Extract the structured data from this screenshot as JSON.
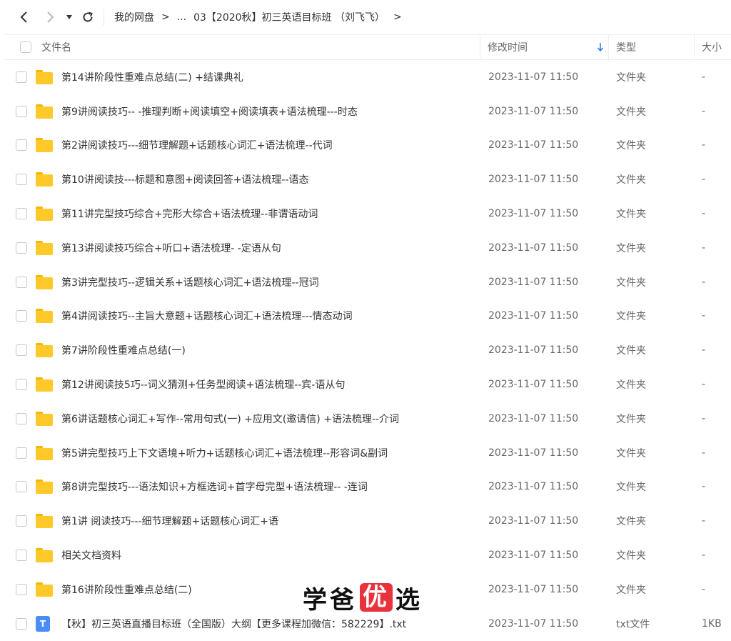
{
  "toolbar": {
    "back_icon": "chevron-left-icon",
    "forward_icon": "chevron-right-icon",
    "dropdown_icon": "caret-down-icon",
    "refresh_icon": "refresh-icon"
  },
  "breadcrumb": {
    "root": "我的网盘",
    "sep": ">",
    "ellipsis": "...",
    "current": "03【2020秋】初三英语目标班 （刘飞飞）",
    "trail_sep": ">"
  },
  "columns": {
    "name": "文件名",
    "modified": "修改时间",
    "type": "类型",
    "size": "大小",
    "sort_icon": "sort-down-arrow-icon"
  },
  "colors": {
    "folder": "#ffc929",
    "txt_icon": "#4a8df8",
    "sort_arrow": "#2f7cf6",
    "watermark_highlight": "#e8323c"
  },
  "files": [
    {
      "name": "第14讲阶段性重难点总结(二) +结课典礼",
      "modified": "2023-11-07 11:50",
      "type": "文件夹",
      "size": "-",
      "icon": "folder-icon"
    },
    {
      "name": "第9讲阅读技巧-- -推理判断+阅读填空+阅读填表+语法梳理---时态",
      "modified": "2023-11-07 11:50",
      "type": "文件夹",
      "size": "-",
      "icon": "folder-icon"
    },
    {
      "name": "第2讲阅读技巧---细节理解题+话题核心词汇+语法梳理--代词",
      "modified": "2023-11-07 11:50",
      "type": "文件夹",
      "size": "-",
      "icon": "folder-icon"
    },
    {
      "name": "第10讲阅读技---标题和意图+阅读回答+语法梳理--语态",
      "modified": "2023-11-07 11:50",
      "type": "文件夹",
      "size": "-",
      "icon": "folder-icon"
    },
    {
      "name": "第11讲完型技巧综合+完形大综合+语法梳理--非谓语动词",
      "modified": "2023-11-07 11:50",
      "type": "文件夹",
      "size": "-",
      "icon": "folder-icon"
    },
    {
      "name": "第13讲阅读技巧综合+听口+语法梳理- -定语从句",
      "modified": "2023-11-07 11:50",
      "type": "文件夹",
      "size": "-",
      "icon": "folder-icon"
    },
    {
      "name": "第3讲完型技巧--逻辑关系+话题核心词汇+语法梳理--冠词",
      "modified": "2023-11-07 11:50",
      "type": "文件夹",
      "size": "-",
      "icon": "folder-icon"
    },
    {
      "name": "第4讲阅读技巧--主旨大意题+话题核心词汇+语法梳理---情态动词",
      "modified": "2023-11-07 11:50",
      "type": "文件夹",
      "size": "-",
      "icon": "folder-icon"
    },
    {
      "name": "第7讲阶段性重难点总结(一)",
      "modified": "2023-11-07 11:50",
      "type": "文件夹",
      "size": "-",
      "icon": "folder-icon"
    },
    {
      "name": "第12讲阅读技5巧--词义猜测+任务型阅读+语法梳理--宾-语从句",
      "modified": "2023-11-07 11:50",
      "type": "文件夹",
      "size": "-",
      "icon": "folder-icon"
    },
    {
      "name": "第6讲话题核心词汇+写作--常用句式(一) +应用文(邀请信) +语法梳理--介词",
      "modified": "2023-11-07 11:50",
      "type": "文件夹",
      "size": "-",
      "icon": "folder-icon"
    },
    {
      "name": "第5讲完型技巧上下文语境+听力+话题核心词汇+语法梳理--形容词&副词",
      "modified": "2023-11-07 11:50",
      "type": "文件夹",
      "size": "-",
      "icon": "folder-icon"
    },
    {
      "name": "第8讲完型技巧---语法知识+方框选词+首字母完型+语法梳理-- -连词",
      "modified": "2023-11-07 11:50",
      "type": "文件夹",
      "size": "-",
      "icon": "folder-icon"
    },
    {
      "name": "第1讲 阅读技巧---细节理解题+话题核心词汇+语",
      "modified": "2023-11-07 11:50",
      "type": "文件夹",
      "size": "-",
      "icon": "folder-icon"
    },
    {
      "name": "相关文档资料",
      "modified": "2023-11-07 11:50",
      "type": "文件夹",
      "size": "-",
      "icon": "folder-icon"
    },
    {
      "name": "第16讲阶段性重难点总结(二)",
      "modified": "2023-11-07 11:50",
      "type": "文件夹",
      "size": "-",
      "icon": "folder-icon"
    },
    {
      "name": "【秋】初三英语直播目标班（全国版）大纲【更多课程加微信：582229】.txt",
      "modified": "2023-11-07 11:50",
      "type": "txt文件",
      "size": "1KB",
      "icon": "txt-file-icon",
      "icon_letter": "T"
    }
  ],
  "watermark": {
    "part1": "学爸",
    "highlight": "优",
    "part2": "选"
  }
}
